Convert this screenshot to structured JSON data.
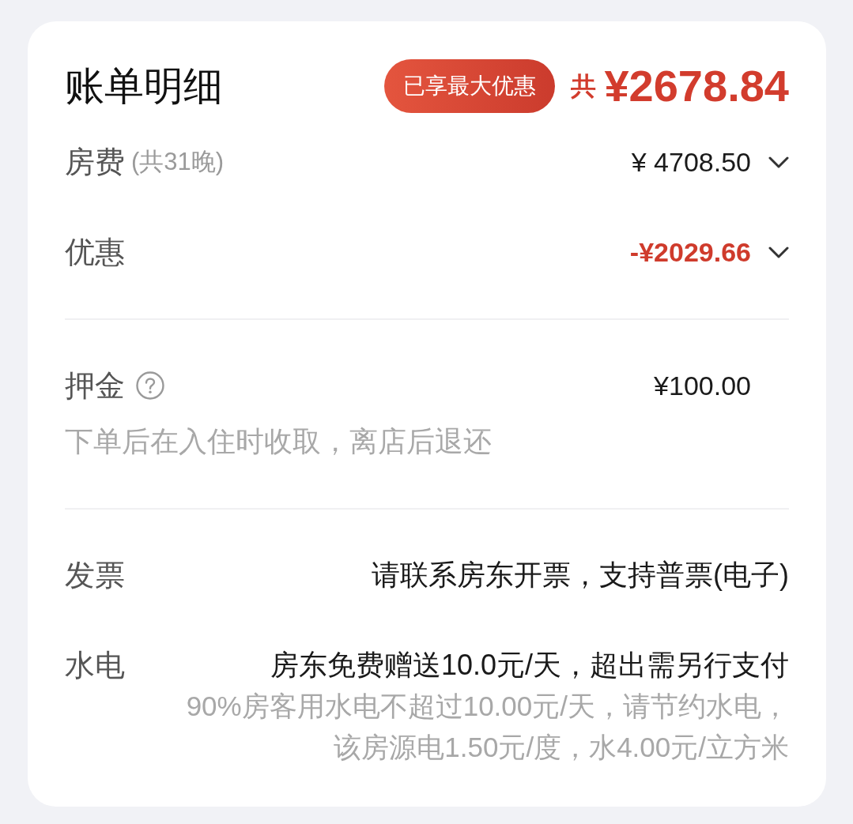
{
  "header": {
    "title": "账单明细",
    "badge": "已享最大优惠",
    "total_prefix": "共",
    "total": "¥2678.84"
  },
  "sections": [
    {
      "rows": [
        {
          "kind": "expandable",
          "label": "房费",
          "label_note": "(共31晚)",
          "amount": "¥ 4708.50",
          "highlight": false,
          "expanded": false
        },
        {
          "kind": "expandable",
          "label": "优惠",
          "amount": "-¥2029.66",
          "highlight": true,
          "expanded": false
        }
      ]
    },
    {
      "rows": [
        {
          "kind": "info",
          "label": "押金",
          "help": true,
          "amount": "¥100.00",
          "note": "下单后在入住时收取，离店后退还"
        }
      ]
    },
    {
      "rows": [
        {
          "kind": "text",
          "label": "发票",
          "value": "请联系房东开票，支持普票(电子)"
        },
        {
          "kind": "text",
          "label": "水电",
          "value": "房东免费赠送10.0元/天，超出需另行支付",
          "notes": [
            "90%房客用水电不超过10.00元/天，请节约水电，",
            "该房源电1.50元/度，水4.00元/立方米"
          ]
        }
      ]
    }
  ]
}
